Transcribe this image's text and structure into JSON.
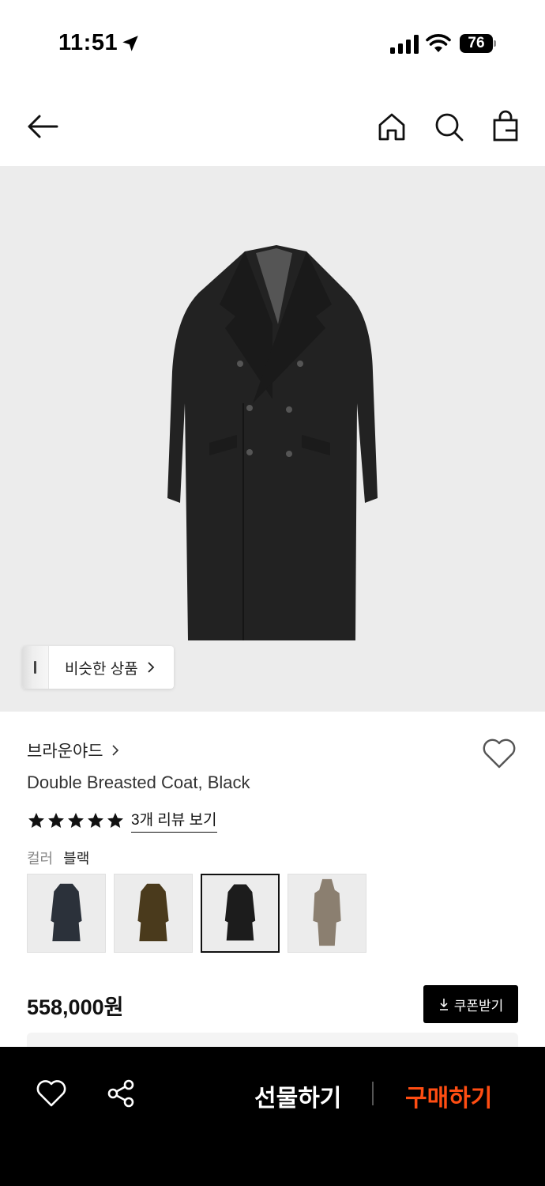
{
  "status_bar": {
    "time": "11:51",
    "battery": "76"
  },
  "nav": {
    "back_icon": "arrow-left-icon",
    "icons": [
      "home-icon",
      "search-icon",
      "shopping-bag-icon"
    ]
  },
  "hero": {
    "similar_label": "비슷한 상품"
  },
  "product": {
    "brand": "브라운야드",
    "title": "Double Breasted Coat, Black",
    "rating_stars": 5,
    "review_link": "3개 리뷰 보기",
    "color_label": "컬러",
    "color_value": "블랙",
    "price": "558,000원",
    "coupon_label": "쿠폰받기"
  },
  "swatches": [
    {
      "color": "#2b313a",
      "selected": false
    },
    {
      "color": "#4a3a1c",
      "selected": false
    },
    {
      "color": "#1c1c1c",
      "selected": true
    },
    {
      "color": "#8b7f70",
      "selected": false
    }
  ],
  "bottom_bar": {
    "gift_label": "선물하기",
    "buy_label": "구매하기",
    "buy_color": "#ff4d12"
  }
}
